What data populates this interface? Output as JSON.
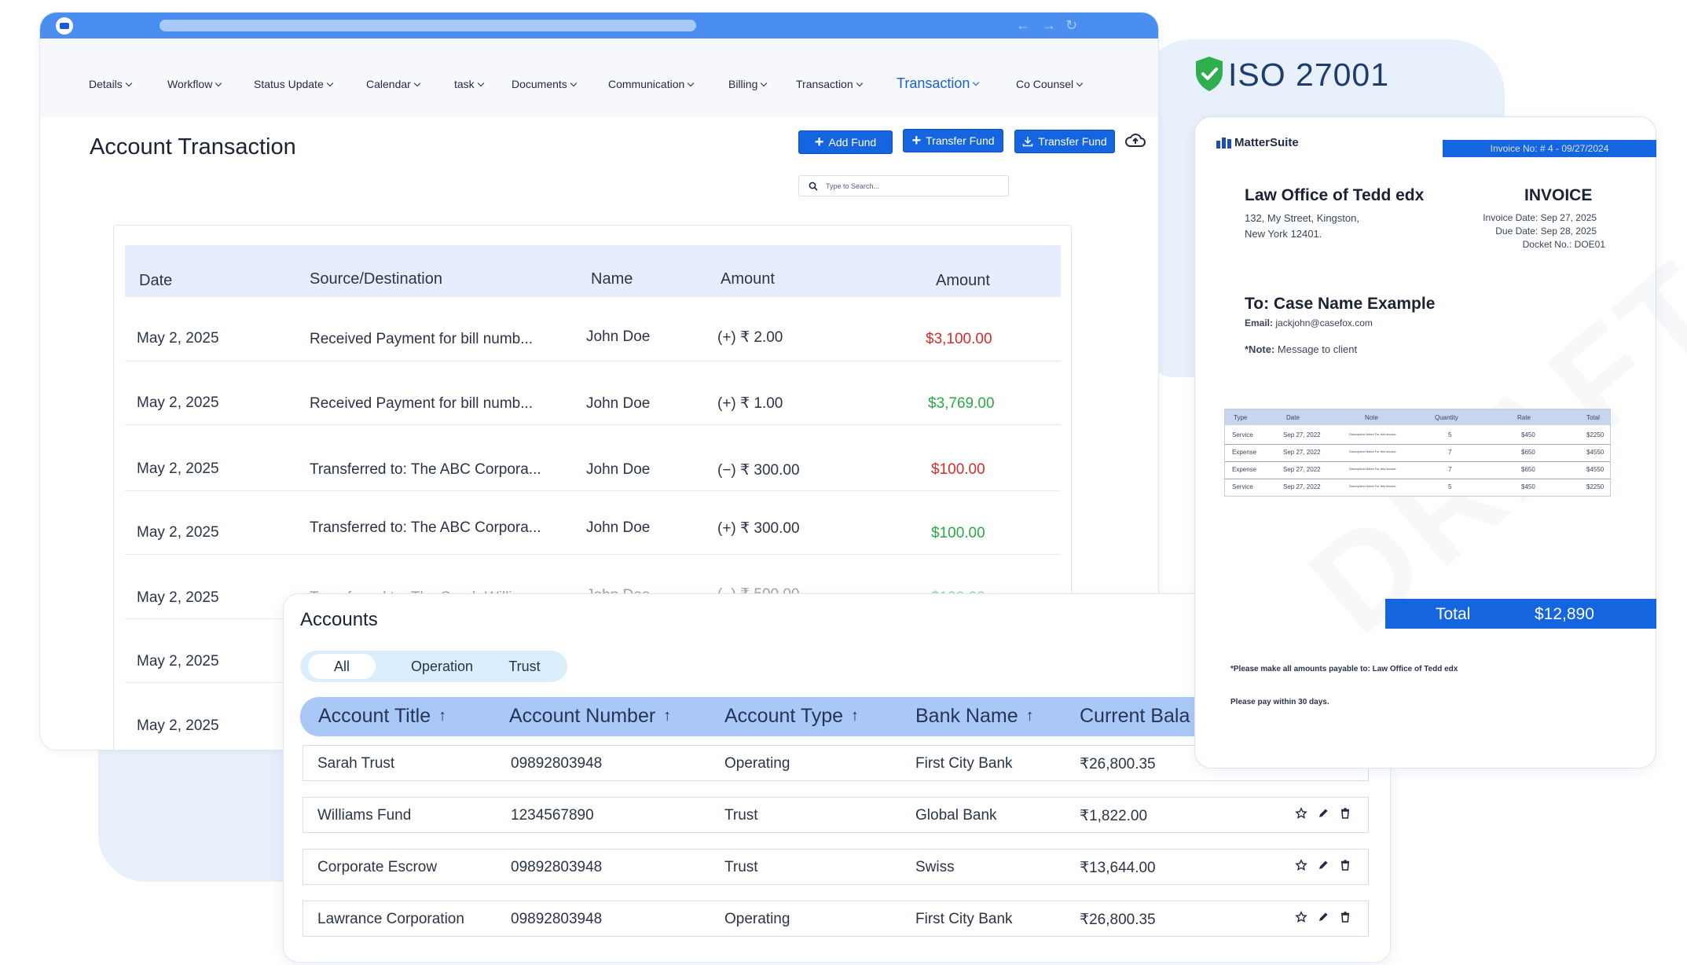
{
  "main_window": {
    "menu": [
      {
        "label": "Details"
      },
      {
        "label": "Workflow"
      },
      {
        "label": "Status Update"
      },
      {
        "label": "Calendar"
      },
      {
        "label": "task"
      },
      {
        "label": "Documents"
      },
      {
        "label": "Communication"
      },
      {
        "label": "Billing"
      },
      {
        "label": "Transaction"
      },
      {
        "label": "Transaction"
      },
      {
        "label": "Co Counsel"
      }
    ],
    "page_title": "Account Transaction",
    "buttons": {
      "add_fund": "Add Fund",
      "transfer_fund_1": "Transfer Fund",
      "transfer_fund_2": "Transfer Fund"
    },
    "search_placeholder": "Type to Search...",
    "table": {
      "headers": [
        "Date",
        "Source/Destination",
        "Name",
        "Amount",
        "Amount"
      ],
      "rows": [
        {
          "date": "May 2, 2025",
          "source": "Received Payment for bill numb...",
          "name": "John Doe",
          "amount": "(+) ₹ 2.00",
          "balance": "$3,100.00",
          "balance_color": "#d22c2c"
        },
        {
          "date": "May 2, 2025",
          "source": "Received Payment for bill numb...",
          "name": "John Doe",
          "amount": "(+) ₹ 1.00",
          "balance": "$3,769.00",
          "balance_color": "#29a845"
        },
        {
          "date": "May 2, 2025",
          "source": "Transferred to: The ABC Corpora...",
          "name": "John Doe",
          "amount": "(−) ₹ 300.00",
          "balance": "$100.00",
          "balance_color": "#d22c2c"
        },
        {
          "date": "May 2, 2025",
          "source": "Transferred to: The ABC Corpora...",
          "name": "John Doe",
          "amount": "(+) ₹ 300.00",
          "balance": "$100.00",
          "balance_color": "#29a845"
        },
        {
          "date": "May 2, 2025",
          "source": "Transferred to: The Sarah Willia...",
          "name": "John Doe",
          "amount": "(−) ₹ 500.00",
          "balance": "$100.00",
          "balance_color": "#29a845"
        },
        {
          "date": "May 2, 2025"
        },
        {
          "date": "May 2, 2025"
        }
      ]
    }
  },
  "accounts": {
    "title": "Accounts",
    "tabs": [
      "All",
      "Operation",
      "Trust"
    ],
    "headers": [
      "Account Title",
      "Account Number",
      "Account Type",
      "Bank Name",
      "Current Bala"
    ],
    "rows": [
      {
        "title": "Sarah Trust",
        "number": "09892803948",
        "type": "Operating",
        "bank": "First City Bank",
        "balance": "₹26,800.35"
      },
      {
        "title": "Williams Fund",
        "number": "1234567890",
        "type": "Trust",
        "bank": "Global Bank",
        "balance": "₹1,822.00"
      },
      {
        "title": "Corporate Escrow",
        "number": "09892803948",
        "type": "Trust",
        "bank": "Swiss",
        "balance": "₹13,644.00"
      },
      {
        "title": "Lawrance Corporation",
        "number": "09892803948",
        "type": "Operating",
        "bank": "First City Bank",
        "balance": "₹26,800.35"
      }
    ]
  },
  "iso": {
    "label": "ISO 27001",
    "shield_color": "#2fae4e"
  },
  "invoice": {
    "brand": "MatterSuite",
    "number_bar": "Invoice  No: # 4 - 09/27/2024",
    "firm": "Law Office of Tedd edx",
    "address_line1": "132, My Street, Kingston,",
    "address_line2": "New York 12401.",
    "heading": "INVOICE",
    "invoice_date": "Invoice Date: Sep 27, 2025",
    "due_date": "Due  Date:  Sep  28, 2025",
    "docket": "Docket No.: DOE01",
    "to": "To: Case Name Example",
    "email_label": "Email:",
    "email": "jackjohn@casefox.com",
    "note_label": "*Note:",
    "note": "Message to client",
    "watermark": "DRAFT",
    "table": {
      "headers": [
        "Type",
        "Date",
        "Note",
        "Quantity",
        "Rate",
        "Total"
      ],
      "rows": [
        [
          "Service",
          "Sep 27, 2022",
          "Description Notes For this invoice",
          "5",
          "$450",
          "$2250"
        ],
        [
          "Expense",
          "Sep 27, 2022",
          "Description Notes For this invoice",
          "7",
          "$650",
          "$4550"
        ],
        [
          "Expense",
          "Sep 27, 2022",
          "Description Notes For this invoice",
          "7",
          "$650",
          "$4550"
        ],
        [
          "Service",
          "Sep 27, 2022",
          "Description Notes For this invoice",
          "5",
          "$450",
          "$2250"
        ]
      ]
    },
    "total_label": "Total",
    "total_value": "$12,890",
    "footer_line1": "*Please make all amounts payable to: Law Office of Tedd edx",
    "footer_line2": "Please pay within 30 days."
  },
  "colors": {
    "accent": "#1564e0",
    "header_blue": "#4a8ef0",
    "red": "#d22c2c",
    "green": "#29a845"
  }
}
